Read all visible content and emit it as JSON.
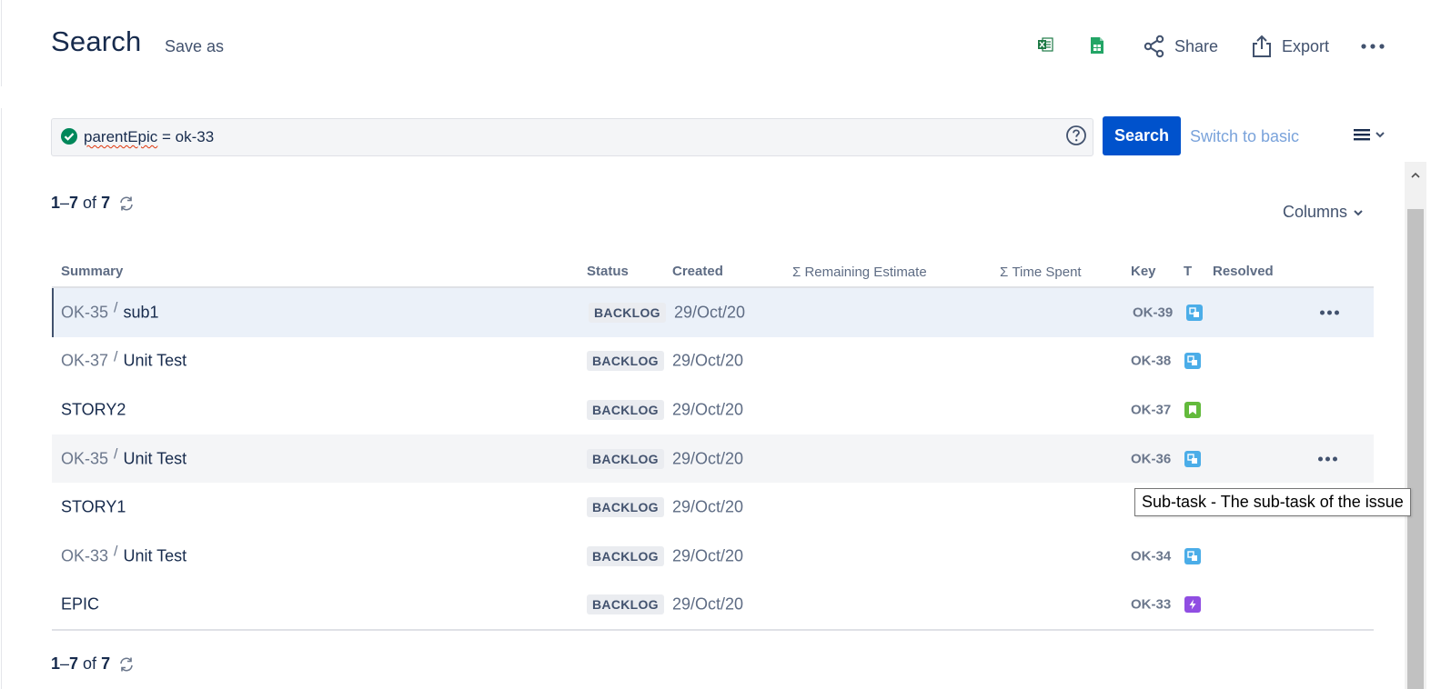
{
  "header": {
    "title": "Search",
    "save_as": "Save as",
    "share": "Share",
    "export": "Export"
  },
  "query": {
    "field": "parentEpic",
    "rest": " = ok-33",
    "search_button": "Search",
    "switch_to_basic": "Switch to basic"
  },
  "results": {
    "range_start": "1",
    "range_end": "7",
    "of": "of",
    "total": "7",
    "columns_label": "Columns"
  },
  "table": {
    "headers": {
      "summary": "Summary",
      "status": "Status",
      "created": "Created",
      "remaining": "Σ Remaining Estimate",
      "time_spent": "Σ Time Spent",
      "key": "Key",
      "type": "T",
      "resolved": "Resolved"
    },
    "rows": [
      {
        "parent": "OK-35",
        "summary": "sub1",
        "status": "BACKLOG",
        "created": "29/Oct/20",
        "key": "OK-39",
        "type": "subtask"
      },
      {
        "parent": "OK-37",
        "summary": "Unit Test",
        "status": "BACKLOG",
        "created": "29/Oct/20",
        "key": "OK-38",
        "type": "subtask"
      },
      {
        "parent": "",
        "summary": "STORY2",
        "status": "BACKLOG",
        "created": "29/Oct/20",
        "key": "OK-37",
        "type": "story"
      },
      {
        "parent": "OK-35",
        "summary": "Unit Test",
        "status": "BACKLOG",
        "created": "29/Oct/20",
        "key": "OK-36",
        "type": "subtask"
      },
      {
        "parent": "",
        "summary": "STORY1",
        "status": "BACKLOG",
        "created": "29/Oct/20",
        "key": "",
        "type": ""
      },
      {
        "parent": "OK-33",
        "summary": "Unit Test",
        "status": "BACKLOG",
        "created": "29/Oct/20",
        "key": "OK-34",
        "type": "subtask"
      },
      {
        "parent": "",
        "summary": "EPIC",
        "status": "BACKLOG",
        "created": "29/Oct/20",
        "key": "OK-33",
        "type": "epic"
      }
    ]
  },
  "tooltip": {
    "text": "Sub-task - The sub-task of the issue"
  },
  "icons": {
    "excel": "excel-export-icon",
    "sheets": "google-sheets-icon",
    "share": "share-icon",
    "export": "export-icon",
    "more": "more-icon",
    "valid": "check-circle-icon",
    "help": "help-icon",
    "list_view": "list-view-icon",
    "refresh": "refresh-icon",
    "chevron": "chevron-down-icon"
  },
  "colors": {
    "primary": "#0052cc",
    "text": "#172b4d",
    "subtask": "#4bade8",
    "story": "#63ba3c",
    "epic": "#904ee2",
    "valid": "#00875a"
  }
}
